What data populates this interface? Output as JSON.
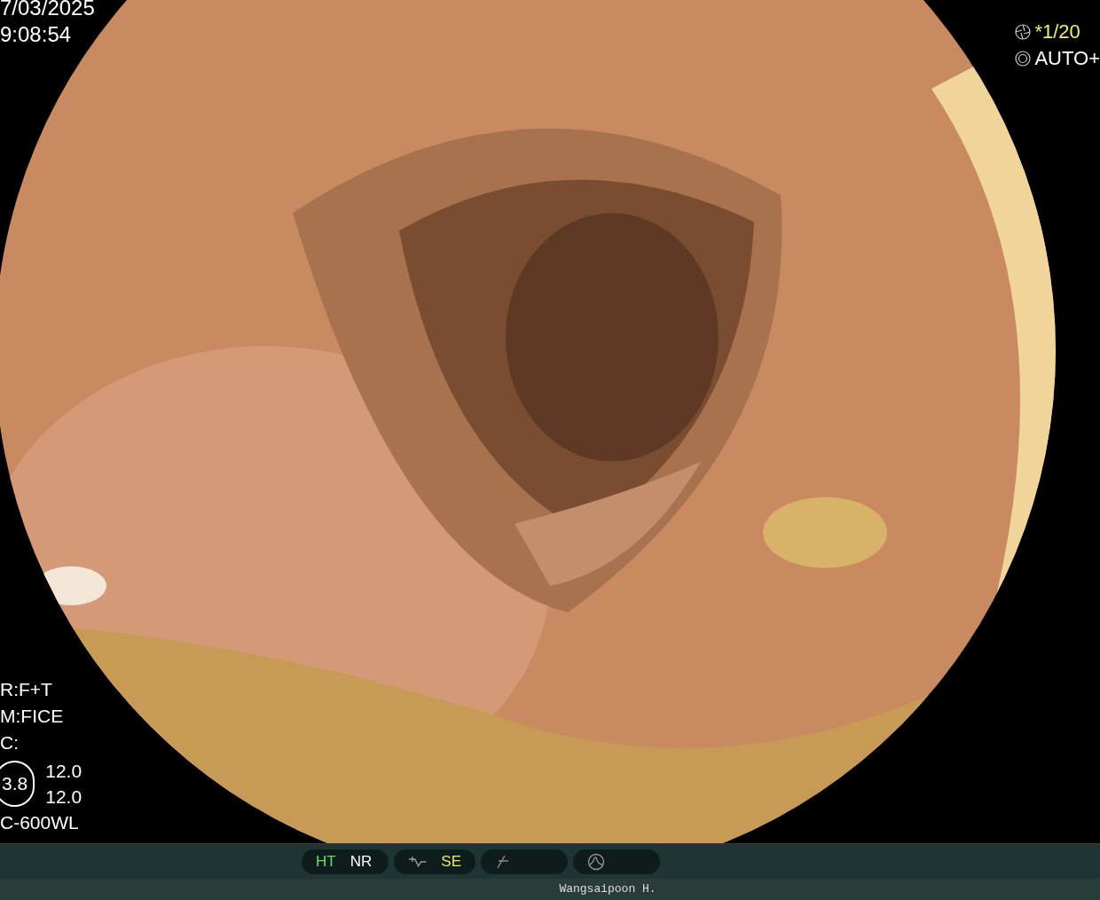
{
  "datetime": {
    "date": "7/03/2025",
    "time": "9:08:54"
  },
  "exposure": {
    "shutter": "*1/20",
    "mode": "AUTO+"
  },
  "settings": [
    "R:F+T",
    "M:FICE",
    "C:"
  ],
  "zoom": {
    "badge": "3.8",
    "values": [
      "12.0",
      "12.0"
    ]
  },
  "scope": "C-600WL",
  "status_pills": [
    {
      "kind": "text",
      "items": [
        {
          "text": "HT",
          "color": "#66dd66"
        },
        {
          "text": "NR",
          "color": "#ffffff"
        }
      ]
    },
    {
      "kind": "curve",
      "items": [
        {
          "text": "SE",
          "color": "#e8e860"
        }
      ]
    },
    {
      "kind": "slash"
    },
    {
      "kind": "wave"
    }
  ],
  "operator": "Wangsaipoon H."
}
